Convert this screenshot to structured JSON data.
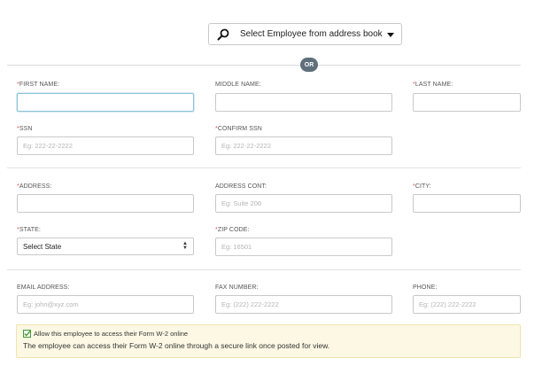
{
  "selector": {
    "label": "Select Employee from address book"
  },
  "or_label": "OR",
  "fields": {
    "first_name": {
      "label": "FIRST NAME:",
      "required": "*",
      "value": "",
      "placeholder": ""
    },
    "middle_name": {
      "label": "MIDDLE NAME:",
      "value": "",
      "placeholder": ""
    },
    "last_name": {
      "label": "LAST NAME:",
      "required": "*",
      "value": "",
      "placeholder": ""
    },
    "ssn": {
      "label": "SSN",
      "required": "*",
      "placeholder": "Eg: 222-22-2222"
    },
    "confirm_ssn": {
      "label": "CONFIRM SSN",
      "required": "*",
      "placeholder": "Eg: 222-22-2222"
    },
    "address": {
      "label": "ADDRESS:",
      "required": "*",
      "placeholder": ""
    },
    "address_cont": {
      "label": "ADDRESS CONT:",
      "placeholder": "Eg: Suite 200"
    },
    "city": {
      "label": "CITY:",
      "required": "*",
      "placeholder": ""
    },
    "state": {
      "label": "STATE:",
      "required": "*",
      "selected": "Select State"
    },
    "zip": {
      "label": "ZIP CODE:",
      "required": "*",
      "placeholder": "Eg: 16501"
    },
    "email": {
      "label": "EMAIL ADDRESS:",
      "placeholder": "Eg: john@xyz.com"
    },
    "fax": {
      "label": "FAX NUMBER:",
      "placeholder": "Eg: (222) 222-2222"
    },
    "phone": {
      "label": "PHONE:",
      "placeholder": "Eg: (222) 222-2222"
    }
  },
  "w2_access": {
    "checkbox_label": "Allow this employee to access their Form W-2 online",
    "checked": true,
    "description": "The employee can access their Form W-2 online through a secure link once posted for view."
  },
  "colors": {
    "required": "#d9534f",
    "or_badge": "#5f6f7b",
    "note_bg": "#fdf8e4",
    "checkbox": "#4a9a3b"
  }
}
